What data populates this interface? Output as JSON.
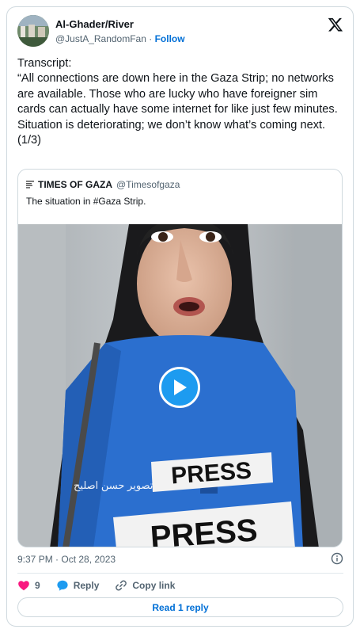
{
  "author": {
    "display_name": "Al-Ghader/River",
    "handle": "@JustA_RandomFan",
    "separator": "·",
    "follow_label": "Follow"
  },
  "tweet": {
    "lines": [
      "Transcript:",
      "“All connections are down here in the Gaza Strip; no networks are available. Those who are lucky who have foreigner sim cards can actually have some internet for like just few minutes. Situation is deteriorating; we don’t know what’s coming next.",
      "(1/3)"
    ]
  },
  "quoted": {
    "account_name": "TIMES OF GAZA",
    "handle": "@Timesofgaza",
    "text": "The situation in #Gaza Strip.",
    "video_caption": "تصوير حسن اصليح",
    "vest_text": "PRESS"
  },
  "meta": {
    "timestamp": "9:37 PM · Oct 28, 2023"
  },
  "actions": {
    "like_count": "9",
    "reply_label": "Reply",
    "copy_link_label": "Copy link"
  },
  "read_replies_label": "Read 1 reply",
  "colors": {
    "accent": "#1d9bf0",
    "link": "#006fd6",
    "like": "#f91880",
    "muted": "#536471",
    "border": "#cfd9de"
  },
  "icons": [
    "x-logo-icon",
    "times-of-gaza-logo-icon",
    "play-icon",
    "info-icon",
    "heart-icon",
    "reply-bubble-icon",
    "link-icon"
  ]
}
